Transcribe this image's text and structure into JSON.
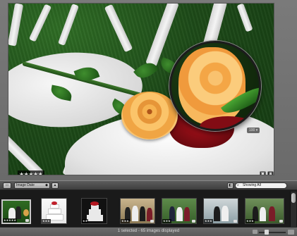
{
  "viewer": {
    "rating_stars": "★★★★★",
    "loupe_zoom": "100 ▾",
    "btn_left_icon": "▣",
    "btn_right_icon": "◙"
  },
  "toolbar": {
    "view_button": "▭",
    "sort_by": "Image Date",
    "sort_chevron": "◆",
    "direction_button": "▲",
    "filter_icon": "◧",
    "search_value": "Showing All",
    "search_icon": "⌕"
  },
  "filmstrip": {
    "thumbnails": [
      {
        "subject": "bride-and-groom-on-lawn",
        "rating": "★★★★★",
        "selected": true
      },
      {
        "subject": "wedding-cake",
        "rating": "★★★",
        "selected": false
      },
      {
        "subject": "wedding-cake-dark",
        "rating": "★★",
        "selected": false
      },
      {
        "subject": "group-photo",
        "rating": "★★★",
        "selected": false
      },
      {
        "subject": "group-photo-outdoor",
        "rating": "★★★",
        "selected": false
      },
      {
        "subject": "couple-portrait",
        "rating": "★★★",
        "selected": false
      },
      {
        "subject": "couple-portrait-2",
        "rating": "★★★",
        "selected": false
      }
    ]
  },
  "status": {
    "text": "1 selected - 65 images displayed"
  }
}
